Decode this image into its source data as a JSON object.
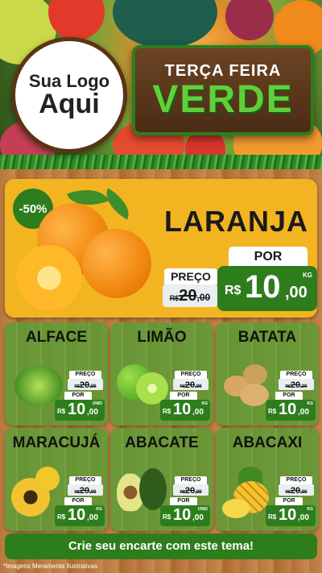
{
  "header": {
    "logo_line1": "Sua Logo",
    "logo_line2": "Aqui",
    "title_top": "TERÇA FEIRA",
    "title_main": "VERDE"
  },
  "colors": {
    "green": "#2e7d1d",
    "yellow": "#f2b521",
    "wood": "#b8773d"
  },
  "feature": {
    "discount": "-50%",
    "name": "LARANJA",
    "preco_label": "PREÇO",
    "old_currency": "R$",
    "old_int": "20",
    "old_dec": ",00",
    "por_label": "POR",
    "new_currency": "R$",
    "new_int": "10",
    "new_dec": ",00",
    "unit": "KG"
  },
  "products": [
    {
      "name": "ALFACE",
      "preco": "PREÇO",
      "old_cur": "R$",
      "old_int": "20",
      "old_dec": ",00",
      "por": "POR",
      "cur": "R$",
      "int": "10",
      "dec": ",00",
      "unit": "UNID",
      "icon": "lettuce-icon"
    },
    {
      "name": "LIMÃO",
      "preco": "PREÇO",
      "old_cur": "R$",
      "old_int": "20",
      "old_dec": ",00",
      "por": "POR",
      "cur": "R$",
      "int": "10",
      "dec": ",00",
      "unit": "KG",
      "icon": "lime-icon"
    },
    {
      "name": "BATATA",
      "preco": "PREÇO",
      "old_cur": "R$",
      "old_int": "20",
      "old_dec": ",00",
      "por": "POR",
      "cur": "R$",
      "int": "10",
      "dec": ",00",
      "unit": "KG",
      "icon": "potato-icon"
    },
    {
      "name": "MARACUJÁ",
      "preco": "PREÇO",
      "old_cur": "R$",
      "old_int": "20",
      "old_dec": ",00",
      "por": "POR",
      "cur": "R$",
      "int": "10",
      "dec": ",00",
      "unit": "KG",
      "icon": "passion-fruit-icon"
    },
    {
      "name": "ABACATE",
      "preco": "PREÇO",
      "old_cur": "R$",
      "old_int": "20",
      "old_dec": ",00",
      "por": "POR",
      "cur": "R$",
      "int": "10",
      "dec": ",00",
      "unit": "UNID",
      "icon": "avocado-icon"
    },
    {
      "name": "ABACAXI",
      "preco": "PREÇO",
      "old_cur": "R$",
      "old_int": "20",
      "old_dec": ",00",
      "por": "POR",
      "cur": "R$",
      "int": "10",
      "dec": ",00",
      "unit": "KG",
      "icon": "pineapple-icon"
    }
  ],
  "cta": "Crie seu encarte com este tema!",
  "footnote": "*Imagens Meramente Ilustrativas"
}
